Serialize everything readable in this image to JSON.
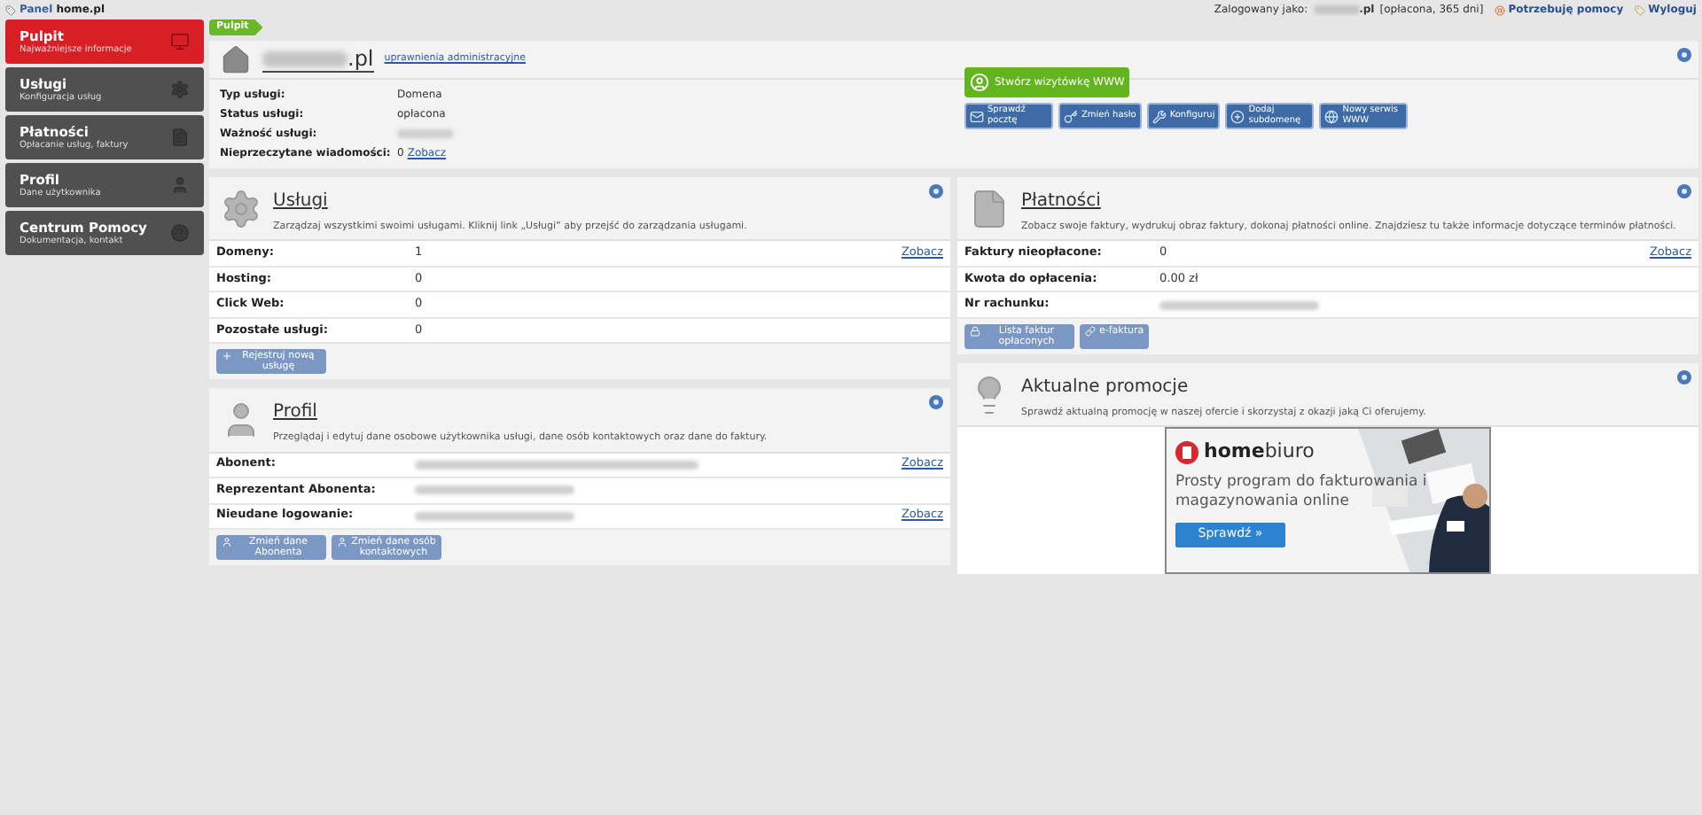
{
  "topbar": {
    "logo": {
      "prefix": "Panel",
      "name": "home.pl"
    },
    "logged_label": "Zalogowany jako:",
    "logged_suffix": ".pl",
    "logged_status": "[opłacona, 365 dni]",
    "links": [
      {
        "kind": "help",
        "label": "Potrzebuję pomocy"
      },
      {
        "kind": "logout",
        "label": "Wyloguj"
      }
    ]
  },
  "sidebar": {
    "items": [
      {
        "kind": "monitor",
        "title": "Pulpit",
        "subtitle": "Najważniejsze informacje",
        "selected": true
      },
      {
        "kind": "gear",
        "title": "Usługi",
        "subtitle": "Konfiguracja usług",
        "selected": false
      },
      {
        "kind": "document",
        "title": "Płatności",
        "subtitle": "Opłacanie usług, faktury",
        "selected": false
      },
      {
        "kind": "person",
        "title": "Profil",
        "subtitle": "Dane użytkownika",
        "selected": false
      },
      {
        "kind": "help",
        "title": "Centrum Pomocy",
        "subtitle": "Dokumentacja, kontakt",
        "selected": false
      }
    ]
  },
  "breadcrumb": "Pulpit",
  "header": {
    "domain_suffix": ".pl",
    "admin_link": "uprawnienia administracyjne",
    "rows": [
      {
        "label": "Typ usługi:",
        "value": "Domena",
        "redacted": false
      },
      {
        "label": "Status usługi:",
        "value": "opłacona",
        "redacted": false
      },
      {
        "label": "Ważność usługi:",
        "redacted": true
      },
      {
        "label": "Nieprzeczytane wiadomości:",
        "value": "0",
        "link": "Zobacz",
        "redacted": false
      }
    ],
    "primary_button": "Stwórz wizytówkę WWW",
    "buttons": [
      {
        "kind": "mail",
        "label": "Sprawdź pocztę"
      },
      {
        "kind": "key",
        "label": "Zmień hasło"
      },
      {
        "kind": "wrench",
        "label": "Konfiguruj"
      },
      {
        "kind": "add",
        "label": "Dodaj subdomenę"
      },
      {
        "kind": "site",
        "label": "Nowy serwis WWW"
      }
    ]
  },
  "panels_left": [
    {
      "kind": "gear",
      "title": "Usługi",
      "description": "Zarządzaj wszystkimi swoimi usługami. Kliknij link „Usługi” aby przejść do zarządzania usługami.",
      "rows": [
        {
          "label": "Domeny:",
          "value": "1",
          "link": "Zobacz",
          "redacted": false
        },
        {
          "label": "Hosting:",
          "value": "0",
          "redacted": false
        },
        {
          "label": "Click Web:",
          "value": "0",
          "redacted": false
        },
        {
          "label": "Pozostałe usługi:",
          "value": "0",
          "redacted": false
        }
      ],
      "buttons": [
        {
          "kind": "plus",
          "label": "Rejestruj nową usługę"
        }
      ]
    },
    {
      "kind": "person",
      "title": "Profil",
      "description": "Przeglądaj i edytuj dane osobowe użytkownika usługi, dane osób kontaktowych oraz dane do faktury.",
      "rows": [
        {
          "label": "Abonent:",
          "redacted": true,
          "link": "Zobacz"
        },
        {
          "label": "Reprezentant Abonenta:",
          "redacted": true
        },
        {
          "label": "Nieudane logowanie:",
          "redacted": true,
          "link": "Zobacz"
        }
      ],
      "buttons": [
        {
          "kind": "person",
          "label": "Zmień dane Abonenta"
        },
        {
          "kind": "person",
          "label": "Zmień dane osób kontaktowych"
        }
      ]
    }
  ],
  "panels_right": [
    {
      "kind": "document",
      "title": "Płatności",
      "description": "Zobacz swoje faktury, wydrukuj obraz faktury, dokonaj płatności online. Znajdziesz tu także informacje dotyczące terminów płatności.",
      "rows": [
        {
          "label": "Faktury nieopłacone:",
          "value": "0",
          "link": "Zobacz",
          "redacted": false
        },
        {
          "label": "Kwota do opłacenia:",
          "value": "0.00 zł",
          "redacted": false
        },
        {
          "label": "Nr rachunku:",
          "redacted": true
        }
      ],
      "buttons": [
        {
          "kind": "lock",
          "label": "Lista faktur opłaconych"
        },
        {
          "kind": "link",
          "label": "e-faktura"
        }
      ]
    },
    {
      "kind": "bulb",
      "title": "Aktualne promocje",
      "description": "Sprawdź aktualną promocję w naszej ofercie i skorzystaj z okazji jaką Ci oferujemy.",
      "ad": {
        "brand": "**home**biuro",
        "headline": "Prosty program do fakturowania i magazynowania online",
        "button": "Sprawdź »"
      }
    }
  ]
}
